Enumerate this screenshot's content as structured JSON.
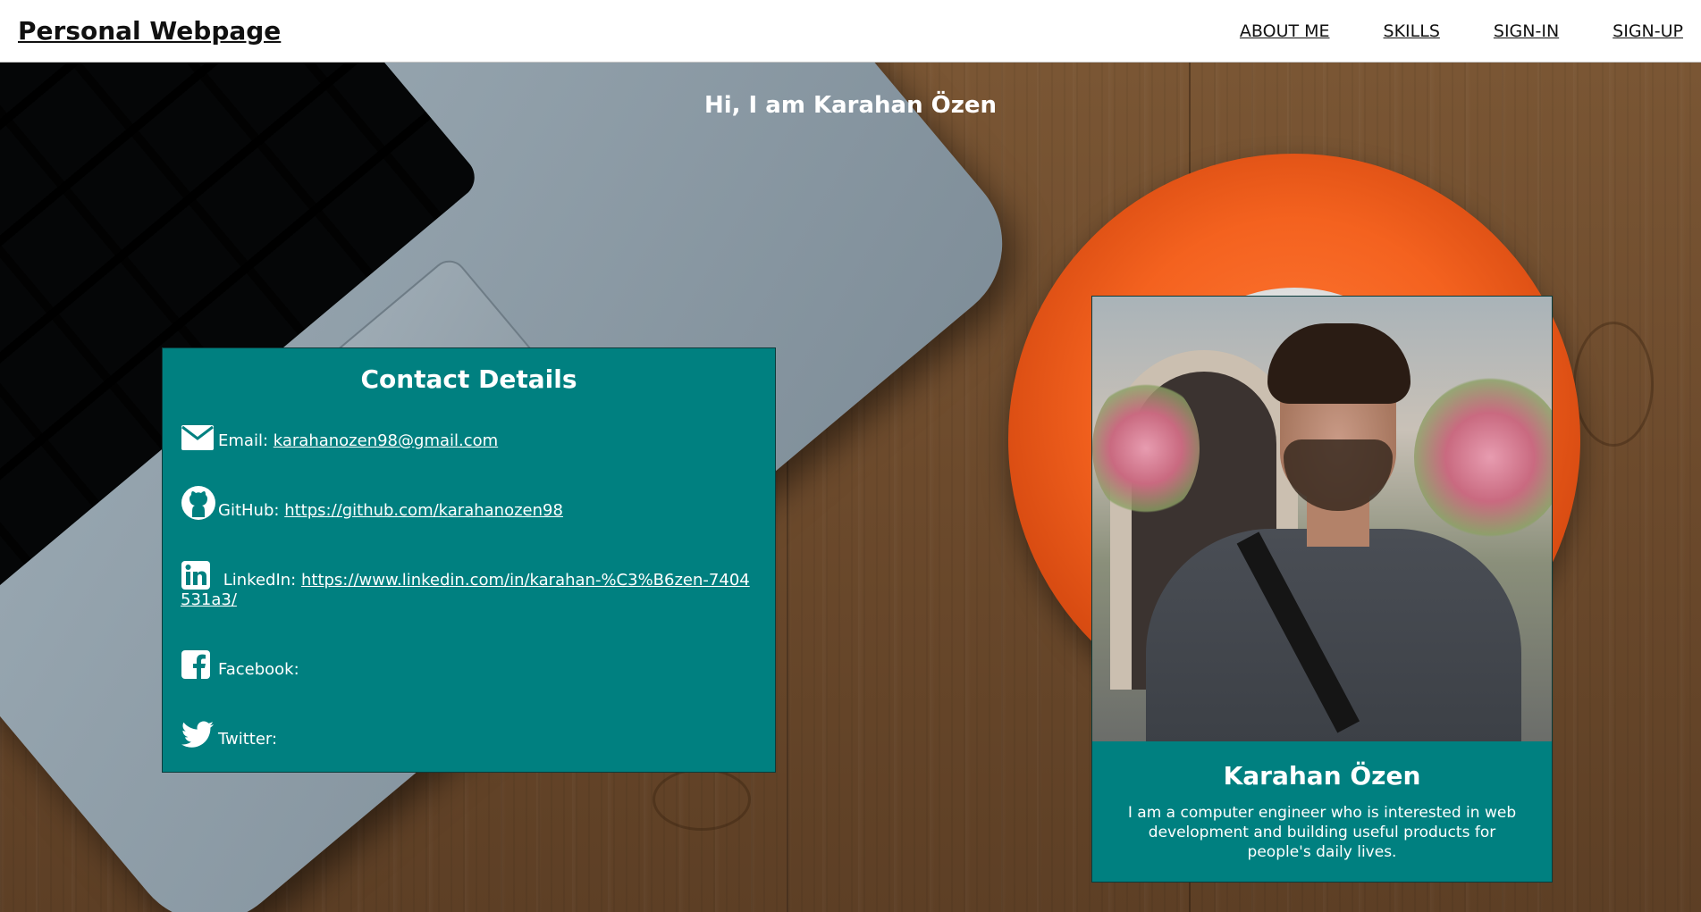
{
  "header": {
    "brand": "Personal Webpage",
    "nav": [
      "ABOUT ME",
      "SKILLS",
      "SIGN-IN",
      "SIGN-UP"
    ]
  },
  "hero": {
    "greeting": "Hi, I am Karahan Özen"
  },
  "contact": {
    "title": "Contact Details",
    "email_label": "Email:",
    "email_value": "karahanozen98@gmail.com",
    "github_label": "GitHub:",
    "github_value": "https://github.com/karahanozen98",
    "linkedin_label": "LinkedIn:",
    "linkedin_value": "https://www.linkedin.com/in/karahan-%C3%B6zen-7404531a3/",
    "facebook_label": "Facebook:",
    "twitter_label": "Twitter:",
    "icons": [
      "mail-icon",
      "github-icon",
      "linkedin-icon",
      "facebook-icon",
      "twitter-icon"
    ]
  },
  "profile": {
    "name": "Karahan Özen",
    "bio": "I am a computer engineer who is interested in web development and building useful products for people's daily lives."
  },
  "colors": {
    "card": "#008080",
    "header_bg": "#ffffff",
    "text_on_card": "#ffffff"
  }
}
